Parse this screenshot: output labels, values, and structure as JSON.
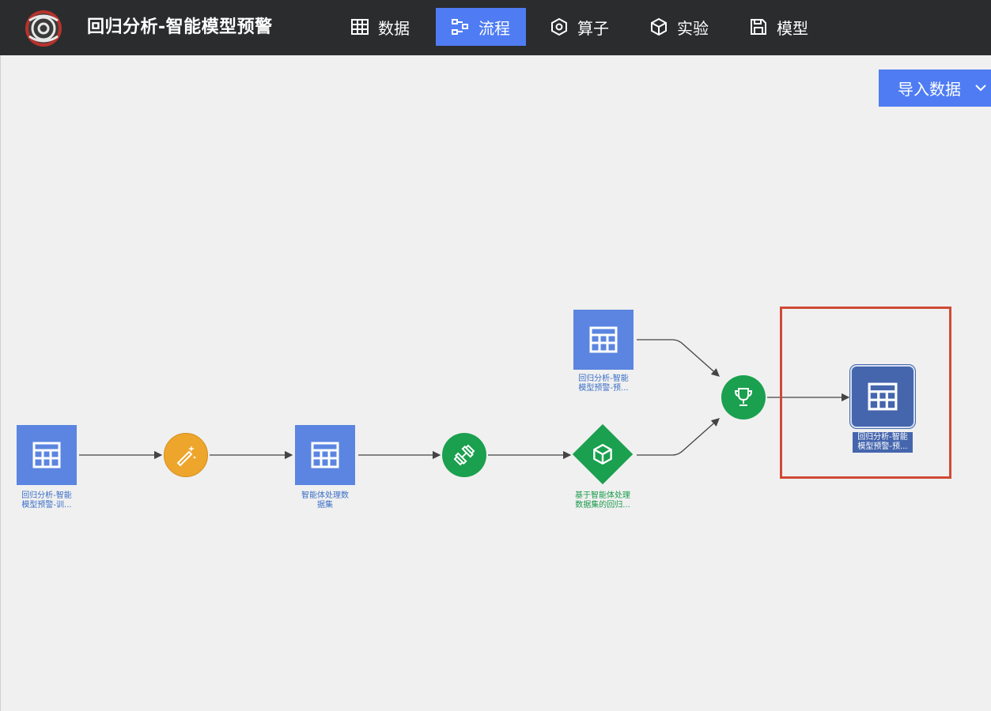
{
  "app": {
    "title": "回归分析-智能模型预警"
  },
  "tabs": [
    {
      "label": "数据",
      "icon": "table-icon",
      "active": false
    },
    {
      "label": "流程",
      "icon": "flow-icon",
      "active": true
    },
    {
      "label": "算子",
      "icon": "hexagon-icon",
      "active": false
    },
    {
      "label": "实验",
      "icon": "cube-icon",
      "active": false
    },
    {
      "label": "模型",
      "icon": "save-icon",
      "active": false
    }
  ],
  "toolbar": {
    "import_label": "导入数据"
  },
  "colors": {
    "accent": "#4f7cf3",
    "dataset_node": "#5b85e0",
    "selected_node": "#4566ad",
    "preprocess_node": "#eda52c",
    "train_node": "#1aa04e",
    "highlight": "#d04a35"
  },
  "nodes": {
    "train_dataset": {
      "label_line1": "回归分析-智能",
      "label_line2": "模型预警-训...",
      "icon": "table-icon"
    },
    "preprocess": {
      "icon": "magic-wand-icon"
    },
    "processed_dataset": {
      "label_line1": "智能体处理数",
      "label_line2": "据集",
      "icon": "table-icon"
    },
    "training": {
      "icon": "dumbbell-icon"
    },
    "model": {
      "label_line1": "基于智能体处理",
      "label_line2": "数据集的回归...",
      "icon": "cube-icon"
    },
    "predict_dataset": {
      "label_line1": "回归分析-智能",
      "label_line2": "模型预警-预...",
      "icon": "table-icon"
    },
    "evaluate": {
      "icon": "trophy-icon"
    },
    "result_dataset": {
      "label_line1": "回归分析-智能",
      "label_line2": "模型预警-预...",
      "icon": "table-icon"
    }
  }
}
